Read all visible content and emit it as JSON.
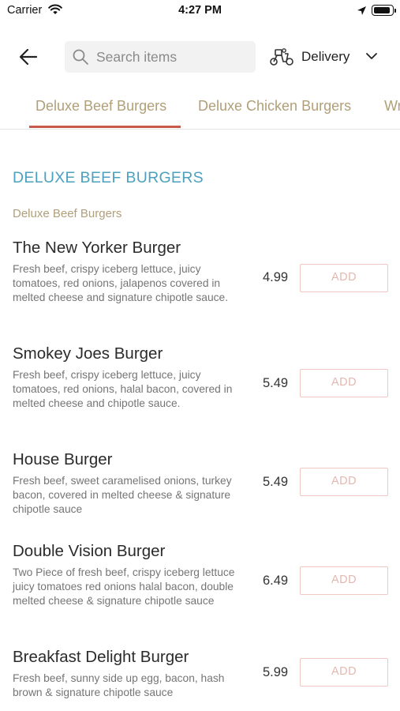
{
  "status_bar": {
    "carrier": "Carrier",
    "time": "4:27 PM"
  },
  "header": {
    "search_placeholder": "Search items",
    "delivery_label": "Delivery",
    "icons": [
      "back-arrow-icon",
      "search-icon",
      "scooter-icon",
      "chevron-down-icon"
    ]
  },
  "tabs": [
    {
      "label": "Deluxe Beef Burgers",
      "active": true
    },
    {
      "label": "Deluxe Chicken Burgers",
      "active": false
    },
    {
      "label": "Wr",
      "active": false
    }
  ],
  "section": {
    "title": "DELUXE BEEF BURGERS",
    "subtitle": "Deluxe Beef Burgers"
  },
  "items": [
    {
      "name": "The New Yorker Burger",
      "description": "Fresh beef, crispy iceberg lettuce, juicy tomatoes, red onions, jalapenos covered in melted cheese and signature chipotle sauce.",
      "price": "4.99",
      "button": "ADD"
    },
    {
      "name": "Smokey Joes Burger",
      "description": "Fresh beef, crispy iceberg lettuce, juicy tomatoes, red onions, halal bacon, covered in melted cheese and chipotle sauce.",
      "price": "5.49",
      "button": "ADD"
    },
    {
      "name": "House Burger",
      "description": "Fresh beef, sweet caramelised onions, turkey bacon, covered in melted cheese & signature chipotle sauce",
      "price": "5.49",
      "button": "ADD"
    },
    {
      "name": "Double Vision Burger",
      "description": "Two Piece of fresh beef, crispy iceberg lettuce juicy tomatoes red onions halal bacon, double melted cheese & signature chipotle sauce",
      "price": "6.49",
      "button": "ADD"
    },
    {
      "name": "Breakfast Delight Burger",
      "description": "Fresh beef, sunny side up egg, bacon, hash brown & signature chipotle sauce",
      "price": "5.99",
      "button": "ADD"
    }
  ],
  "colors": {
    "accent_tab": "#b09f78",
    "tab_underline": "#c6594a",
    "section_title": "#4da0c0",
    "add_button_border": "#efc8c2"
  }
}
